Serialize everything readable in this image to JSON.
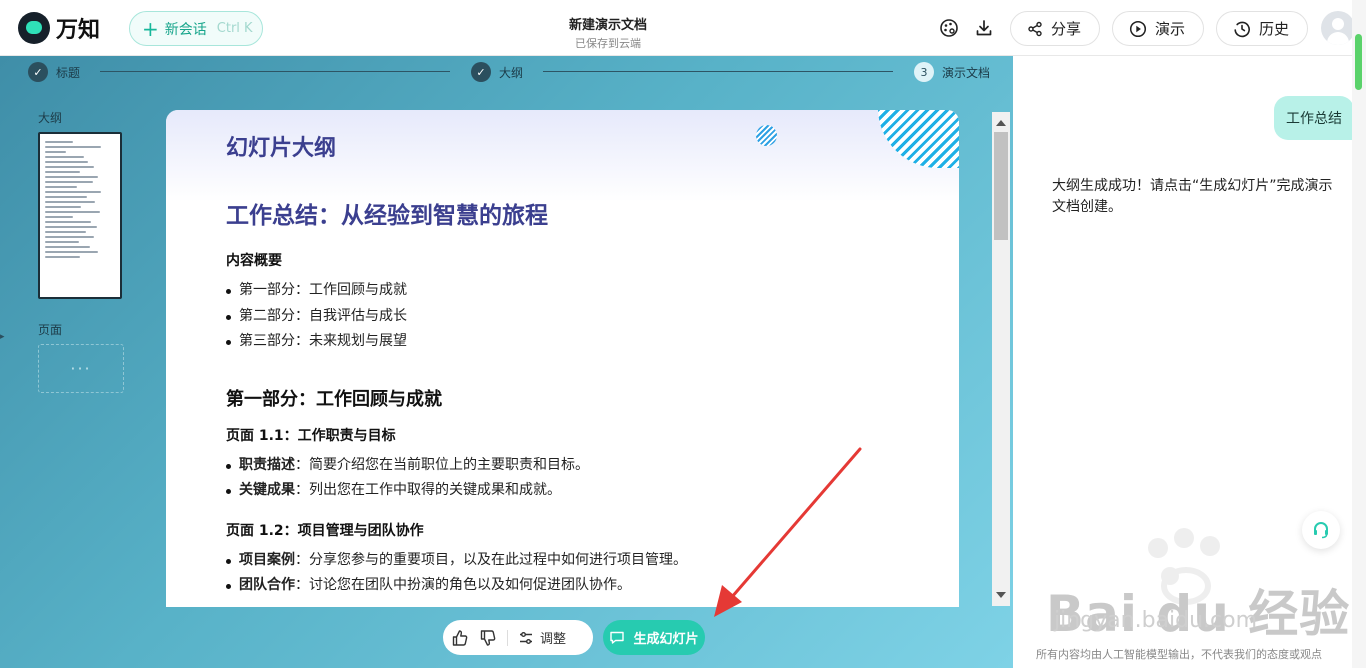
{
  "app": {
    "name": "万知",
    "new_chat_label": "新会话",
    "new_chat_shortcut": "Ctrl K"
  },
  "document": {
    "title": "新建演示文档",
    "status": "已保存到云端"
  },
  "header_actions": {
    "share": "分享",
    "present": "演示",
    "history": "历史"
  },
  "steps": [
    {
      "label": "标题",
      "state": "done"
    },
    {
      "label": "大纲",
      "state": "done"
    },
    {
      "label": "演示文档",
      "state": "current",
      "number": "3"
    }
  ],
  "sidebar": {
    "outline_label": "大纲",
    "pages_label": "页面",
    "page_placeholder": "···"
  },
  "slide": {
    "heading": "幻灯片大纲",
    "title": "工作总结：从经验到智慧的旅程",
    "overview_heading": "内容概要",
    "overview_items": [
      "第一部分：工作回顾与成就",
      "第二部分：自我评估与成长",
      "第三部分：未来规划与展望"
    ],
    "part1_heading": "第一部分：工作回顾与成就",
    "page11_heading": "页面 1.1：工作职责与目标",
    "page11_items": [
      {
        "term": "职责描述",
        "text": "：简要介绍您在当前职位上的主要职责和目标。"
      },
      {
        "term": "关键成果",
        "text": "：列出您在工作中取得的关键成果和成就。"
      }
    ],
    "page12_heading": "页面 1.2：项目管理与团队协作",
    "page12_items": [
      {
        "term": "项目案例",
        "text": "：分享您参与的重要项目，以及在此过程中如何进行项目管理。"
      },
      {
        "term": "团队合作",
        "text": "：讨论您在团队中扮演的角色以及如何促进团队协作。"
      }
    ]
  },
  "action_bar": {
    "adjust_label": "调整",
    "generate_label": "生成幻灯片"
  },
  "chat": {
    "user_message": "工作总结",
    "bot_message": "大纲生成成功！请点击“生成幻灯片”完成演示文档创建。",
    "disclaimer": "所有内容均由人工智能模型输出，不代表我们的态度或观点"
  },
  "watermark": {
    "text": "Bai du 经验",
    "sub": "jingyan.baidu.com"
  },
  "colors": {
    "accent": "#27cbb0",
    "slide_heading": "#3b3f8f",
    "workspace_bg": "#58b2c8",
    "annotation_arrow": "#e53935"
  }
}
